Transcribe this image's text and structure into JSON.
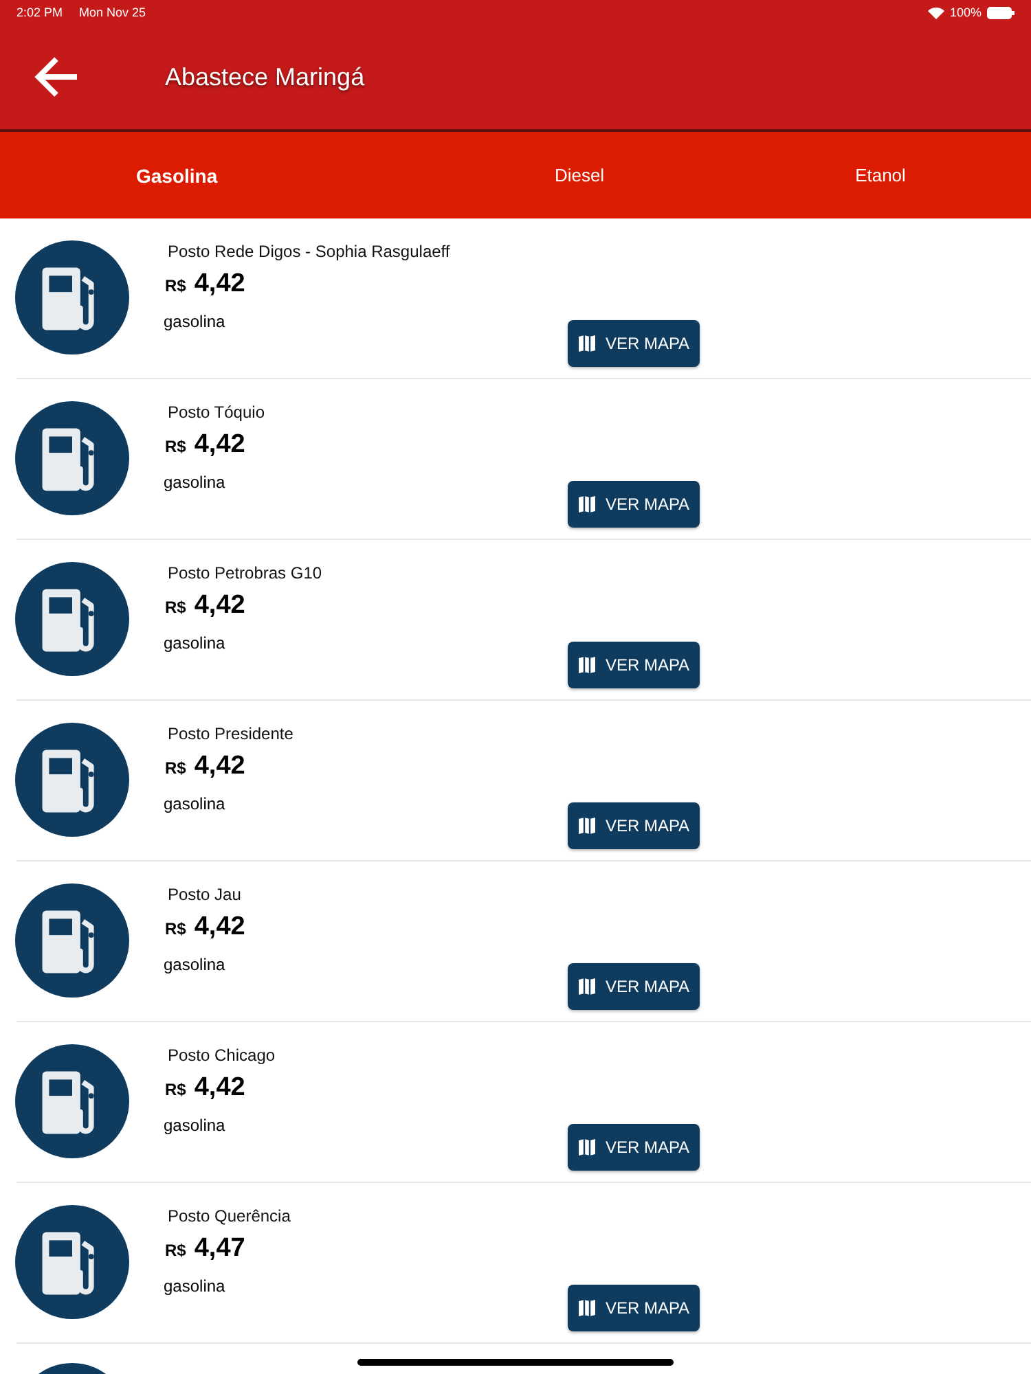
{
  "status_bar": {
    "time": "2:02 PM",
    "date": "Mon Nov 25",
    "battery": "100%"
  },
  "header": {
    "title": "Abastece Maringá"
  },
  "tabs": [
    {
      "label": "Gasolina",
      "selected": true
    },
    {
      "label": "Diesel",
      "selected": false
    },
    {
      "label": "Etanol",
      "selected": false
    }
  ],
  "stations": [
    {
      "name": "Posto Rede Digos - Sophia Rasgulaeff",
      "currency": "R$",
      "price": "4,42",
      "fuel": "gasolina",
      "button": "VER MAPA"
    },
    {
      "name": "Posto Tóquio",
      "currency": "R$",
      "price": "4,42",
      "fuel": "gasolina",
      "button": "VER MAPA"
    },
    {
      "name": "Posto Petrobras G10",
      "currency": "R$",
      "price": "4,42",
      "fuel": "gasolina",
      "button": "VER MAPA"
    },
    {
      "name": "Posto Presidente",
      "currency": "R$",
      "price": "4,42",
      "fuel": "gasolina",
      "button": "VER MAPA"
    },
    {
      "name": "Posto Jau",
      "currency": "R$",
      "price": "4,42",
      "fuel": "gasolina",
      "button": "VER MAPA"
    },
    {
      "name": "Posto Chicago",
      "currency": "R$",
      "price": "4,42",
      "fuel": "gasolina",
      "button": "VER MAPA"
    },
    {
      "name": "Posto Querência",
      "currency": "R$",
      "price": "4,47",
      "fuel": "gasolina",
      "button": "VER MAPA"
    }
  ]
}
